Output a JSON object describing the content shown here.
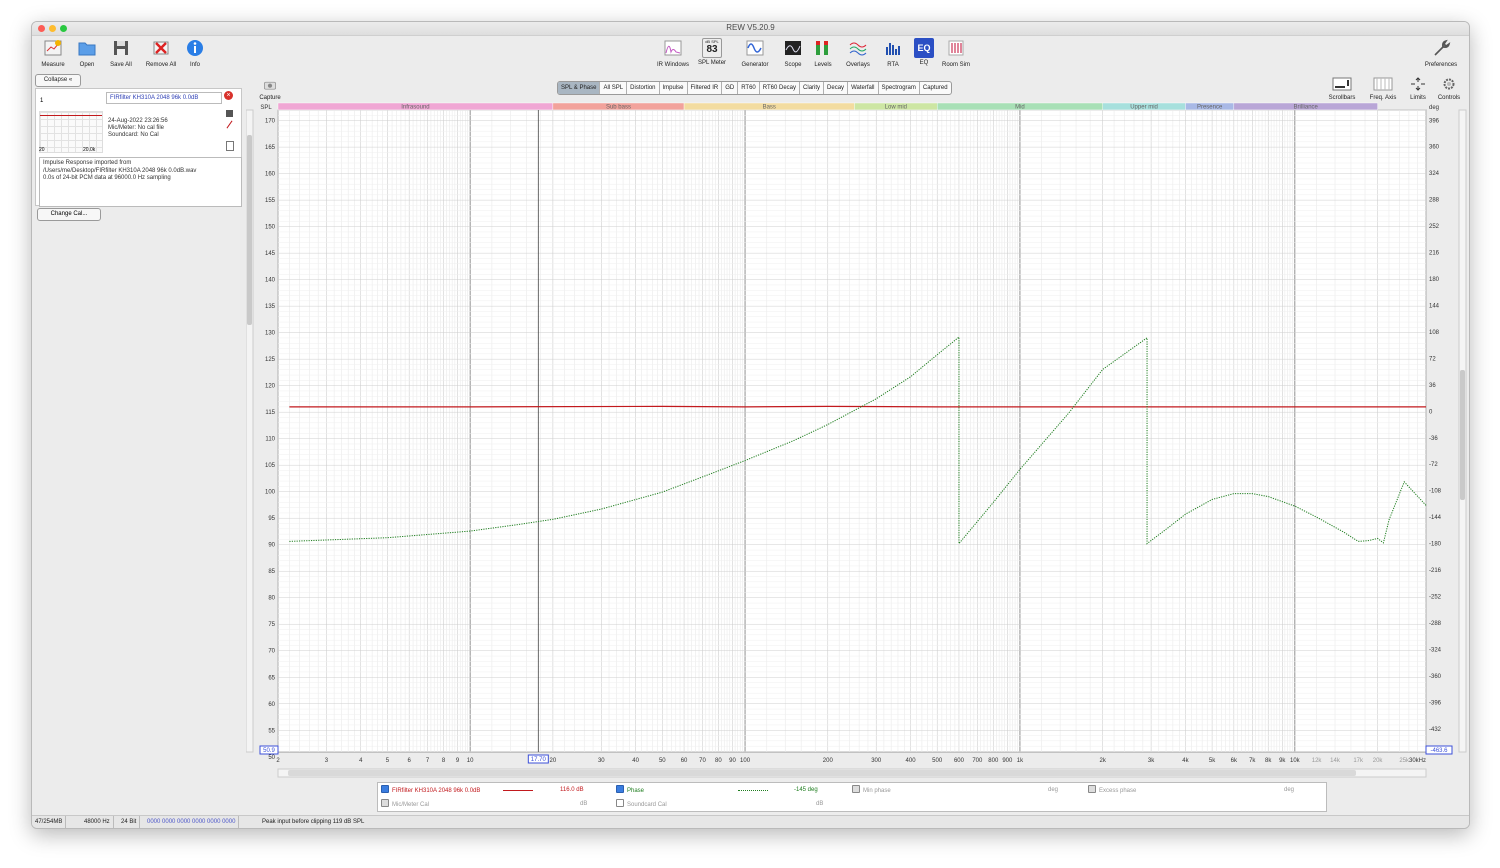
{
  "window": {
    "title": "REW V5.20.9"
  },
  "toolbar_left": [
    {
      "label": "Measure",
      "icon": "measure-icon"
    },
    {
      "label": "Open",
      "icon": "folder-icon"
    },
    {
      "label": "Save All",
      "icon": "save-icon"
    },
    {
      "label": "Remove All",
      "icon": "remove-icon"
    },
    {
      "label": "Info",
      "icon": "info-icon"
    }
  ],
  "toolbar_center": [
    {
      "label": "IR Windows",
      "icon": "ir-windows-icon"
    },
    {
      "label": "SPL Meter",
      "icon": "spl-meter-icon",
      "badge_top": "dB SPL",
      "badge_value": "83"
    },
    {
      "label": "Generator",
      "icon": "generator-icon"
    },
    {
      "label": "Scope",
      "icon": "scope-icon"
    },
    {
      "label": "Levels",
      "icon": "levels-icon"
    },
    {
      "label": "Overlays",
      "icon": "overlays-icon"
    },
    {
      "label": "RTA",
      "icon": "rta-icon"
    },
    {
      "label": "EQ",
      "icon": "eq-icon"
    },
    {
      "label": "Room Sim",
      "icon": "room-sim-icon"
    }
  ],
  "toolbar_right": {
    "preferences": "Preferences"
  },
  "graph_tools": {
    "capture": "Capture",
    "scrollbars": "Scrollbars",
    "freq_axis": "Freq. Axis",
    "limits": "Limits",
    "controls": "Controls"
  },
  "measurement": {
    "collapse": "Collapse",
    "index": "1",
    "name": "FIRfilter KH310A 2048 96k 0.0dB",
    "date": "24-Aug-2022 23:26:56",
    "mic": "Mic/Meter: No cal file",
    "soundcard": "Soundcard: No Cal",
    "thumb_min": "20",
    "thumb_max": "20.0k",
    "notes": [
      "Impulse Response imported from",
      "/Users/me/Desktop/FIRfilter KH310A 2048 96k 0.0dB.wav",
      "0.0s of 24-bit PCM data at 96000.0 Hz sampling"
    ],
    "change_cal": "Change Cal..."
  },
  "tabs": [
    "SPL & Phase",
    "All SPL",
    "Distortion",
    "Impulse",
    "Filtered IR",
    "GD",
    "RT60",
    "RT60 Decay",
    "Clarity",
    "Decay",
    "Waterfall",
    "Spectrogram",
    "Captured"
  ],
  "active_tab": "SPL & Phase",
  "bands": [
    {
      "label": "Infrasound",
      "from": 2,
      "to": 20,
      "color": "#f0a6d4"
    },
    {
      "label": "Sub bass",
      "from": 20,
      "to": 60,
      "color": "#f2a29b"
    },
    {
      "label": "Bass",
      "from": 60,
      "to": 250,
      "color": "#f3dca0"
    },
    {
      "label": "Low mid",
      "from": 250,
      "to": 500,
      "color": "#cde6a3"
    },
    {
      "label": "Mid",
      "from": 500,
      "to": 2000,
      "color": "#a8e0b6"
    },
    {
      "label": "Upper mid",
      "from": 2000,
      "to": 4000,
      "color": "#a7e0dd"
    },
    {
      "label": "Presence",
      "from": 4000,
      "to": 6000,
      "color": "#a9b9e6"
    },
    {
      "label": "Brilliance",
      "from": 6000,
      "to": 20000,
      "color": "#b9a6d7"
    }
  ],
  "chart_data": {
    "type": "line",
    "xscale": "log",
    "xlim": [
      2,
      30000
    ],
    "x_ticks": [
      "2",
      "3",
      "4",
      "5",
      "6",
      "7",
      "8",
      "9",
      "10",
      "20",
      "30",
      "40",
      "50",
      "60",
      "70",
      "80",
      "90",
      "100",
      "200",
      "300",
      "400",
      "500",
      "600",
      "700",
      "800",
      "900",
      "1k",
      "2k",
      "3k",
      "4k",
      "5k",
      "6k",
      "7k",
      "8k",
      "9k",
      "10k",
      "12k",
      "14k",
      "17k",
      "20k",
      "25k",
      "30kHz"
    ],
    "ylabel_left": "SPL",
    "ylim_left": [
      50.9,
      172
    ],
    "y_ticks_left": [
      "170",
      "165",
      "160",
      "155",
      "150",
      "145",
      "140",
      "135",
      "130",
      "125",
      "120",
      "115",
      "110",
      "105",
      "100",
      "95",
      "90",
      "85",
      "80",
      "75",
      "70",
      "65",
      "60",
      "55",
      "50"
    ],
    "ylabel_right": "deg",
    "ylim_right": [
      -463.6,
      410
    ],
    "y_ticks_right": [
      "396",
      "360",
      "324",
      "288",
      "252",
      "216",
      "180",
      "144",
      "108",
      "72",
      "36",
      "0",
      "-36",
      "-72",
      "-108",
      "-144",
      "-180",
      "-216",
      "-252",
      "-288",
      "-324",
      "-360",
      "-396",
      "-432"
    ],
    "left_limit_label": "50.9",
    "right_limit_label": "-463.6",
    "cursor_label": "17.70",
    "cursor_x": 17.7,
    "series": [
      {
        "name": "FIRfilter KH310A 2048 96k 0.0dB",
        "axis": "left",
        "color": "#c2191d",
        "x": [
          2.2,
          10,
          50,
          100,
          200,
          500,
          1000,
          3000,
          10000,
          30000
        ],
        "y": [
          116,
          116,
          116.1,
          116,
          116.1,
          116,
          116,
          116,
          116,
          116
        ]
      },
      {
        "name": "Phase",
        "axis": "right",
        "color": "#1e7d1e",
        "dash": true,
        "x": [
          2.2,
          5,
          10,
          15,
          20,
          30,
          50,
          75,
          100,
          150,
          200,
          300,
          400,
          500,
          600,
          600,
          800,
          1000,
          1500,
          2000,
          2900,
          2900,
          3500,
          4000,
          5000,
          6000,
          7000,
          8000,
          10000,
          12000,
          15000,
          17000,
          18500,
          20000,
          21000,
          22000,
          25000,
          30000
        ],
        "y": [
          -177,
          -172,
          -163,
          -154,
          -147,
          -133,
          -110,
          -85,
          -67,
          -40,
          -18,
          17,
          47,
          77,
          101,
          -180,
          -124,
          -79,
          -3,
          57,
          100,
          -180,
          -157,
          -140,
          -120,
          -112,
          -112,
          -116,
          -129,
          -144,
          -164,
          -177,
          -176,
          -173,
          -179,
          -148,
          -96,
          -128
        ]
      }
    ]
  },
  "legend": {
    "row1": {
      "name": "FIRfilter KH310A 2048 96k 0.0dB",
      "spl_value": "116.0 dB",
      "phase": "Phase",
      "phase_value": "-145 deg",
      "min_phase": "Min phase",
      "min_unit": "deg",
      "excess_phase": "Excess phase",
      "excess_unit": "deg"
    },
    "row2": {
      "mic_cal": "Mic/Meter Cal",
      "mic_unit": "dB",
      "soundcard_cal": "Soundcard Cal",
      "soundcard_unit": "dB"
    }
  },
  "status": {
    "memory": "47/254MB",
    "rate": "48000 Hz",
    "bits": "24 Bit",
    "meter": "0000 0000  0000 0000  0000 0000",
    "peak": "Peak input before clipping 119 dB SPL"
  }
}
